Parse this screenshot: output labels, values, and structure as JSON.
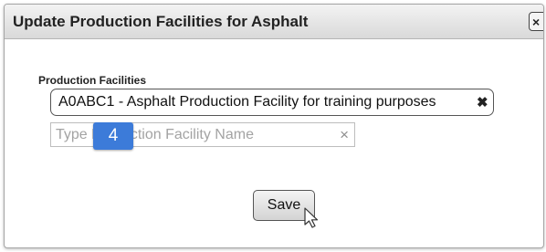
{
  "dialog": {
    "title": "Update Production Facilities for Asphalt",
    "close_icon": "close-icon",
    "close_glyph": "×"
  },
  "form": {
    "field_label": "Production Facilities",
    "selected_token": {
      "text": "A0ABC1 - Asphalt Production Facility for training purposes",
      "remove_icon": "remove-token-icon",
      "remove_glyph": "✖"
    },
    "search": {
      "placeholder": "Type Production Facility Name",
      "value": "",
      "clear_icon": "clear-icon",
      "clear_glyph": "×"
    }
  },
  "step_badge": "4",
  "actions": {
    "save_label": "Save"
  },
  "colors": {
    "badge": "#3c7bd9",
    "titlebar": "#dcdcdc"
  }
}
